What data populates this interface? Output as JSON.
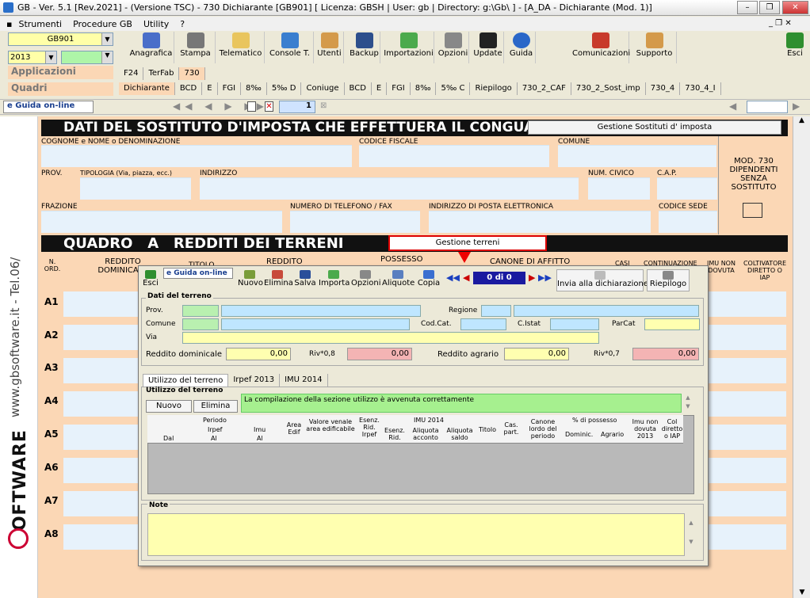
{
  "window": {
    "title": "GB - Ver. 5.1 [Rev.2021] - (Versione TSC) - 730 Dichiarante [GB901]    [ Licenza: GBSH | User: gb | Directory: g:\\Gb\\ ] - [A_DA - Dichiarante (Mod. 1)]"
  },
  "menu": [
    "Strumenti",
    "Procedure GB",
    "Utility",
    "?"
  ],
  "left": {
    "code": "GB901",
    "year": "2013",
    "applicazioni": "Applicazioni",
    "quadri": "Quadri"
  },
  "toolbar": [
    "Anagrafica",
    "Stampa",
    "Telematico",
    "Console T.",
    "Utenti",
    "Backup",
    "Importazioni",
    "Opzioni",
    "Update",
    "Guida"
  ],
  "toolbar_right": [
    "Comunicazioni",
    "Supporto"
  ],
  "exit": "Esci",
  "tabs1": [
    "F24",
    "TerFab",
    "730"
  ],
  "tabs2": [
    "Dichiarante",
    "BCD",
    "E",
    "FGI",
    "8‰",
    "5‰ D",
    "Coniuge",
    "BCD",
    "E",
    "FGI",
    "8‰",
    "5‰ C",
    "Riepilogo",
    "730_2_CAF",
    "730_2_Sost_imp",
    "730_4",
    "730_4_I"
  ],
  "nav": {
    "guide": "Guida on-line",
    "page": "1"
  },
  "sidebar": {
    "brand": "SOFTWARE",
    "url": "www.gbsoftware.it - Tel.06/"
  },
  "sostituto": {
    "heading": "DATI DEL SOSTITUTO D'IMPOSTA CHE EFFETTUERA IL CONGUAGLIO",
    "manage": "Gestione Sostituti d' imposta",
    "cognome": "COGNOME e NOME o DENOMINAZIONE",
    "cf": "CODICE FISCALE",
    "comune": "COMUNE",
    "prov": "PROV.",
    "tipologia": "TIPOLOGIA (Via, piazza, ecc.)",
    "indirizzo": "INDIRIZZO",
    "civico": "NUM. CIVICO",
    "cap": "C.A.P.",
    "frazione": "FRAZIONE",
    "telefono": "NUMERO DI TELEFONO / FAX",
    "email": "INDIRIZZO DI POSTA ELETTRONICA",
    "sede": "CODICE SEDE",
    "mod730": "MOD. 730 DIPENDENTI SENZA SOSTITUTO"
  },
  "quadro": {
    "heading": "QUADRO   A   REDDITI DEI TERRENI",
    "manage": "Gestione terreni",
    "cols": [
      "N. ORD.",
      "REDDITO DOMINICALE",
      "TITOLO",
      "REDDITO",
      "POSSESSO",
      "CANONE DI AFFITTO",
      "CASI",
      "CONTINUAZIONE",
      "IMU NON DOVUTA",
      "COLTIVATORE DIRETTO O IAP"
    ],
    "rows": [
      "A1",
      "A2",
      "A3",
      "A4",
      "A5",
      "A6",
      "A7",
      "A8"
    ]
  },
  "dialog": {
    "buttons": [
      "Esci",
      "Guida on-line",
      "Nuovo",
      "Elimina",
      "Salva",
      "Importa",
      "Opzioni",
      "Aliquote",
      "Copia"
    ],
    "counter": "0 di 0",
    "invia": "Invia alla dichiarazione",
    "riepilogo": "Riepilogo",
    "section": "Dati del terreno",
    "prov": "Prov.",
    "regione": "Regione",
    "comune": "Comune",
    "codcat": "Cod.Cat.",
    "cistat": "C.Istat",
    "parcat": "ParCat",
    "via": "Via",
    "rd_label": "Reddito dominicale",
    "rd": "0,00",
    "rd8_label": "Riv*0,8",
    "rd8": "0,00",
    "ra_label": "Reddito agrario",
    "ra": "0,00",
    "ra7_label": "Riv*0,7",
    "ra7": "0,00",
    "tabs": [
      "Utilizzo del terreno",
      "Irpef 2013",
      "IMU 2014"
    ],
    "util_title": "Utilizzo del terreno",
    "nuovo": "Nuovo",
    "elimina": "Elimina",
    "msg": "La compilazione della sezione utilizzo è avvenuta correttamente",
    "grid": {
      "periodo": "Periodo",
      "irpef": "Irpef",
      "imu": "Imu",
      "dal": "Dal",
      "al1": "Al",
      "al2": "Al",
      "area": "Area Edif",
      "venale": "Valore venale area edificabile",
      "esenz": "Esenz. Rid. Irpef",
      "imu2014": "IMU 2014",
      "esenz2": "Esenz. Rid.",
      "acconto": "Aliquota acconto",
      "saldo": "Aliquota saldo",
      "titolo": "Titolo",
      "cas": "Cas. part.",
      "canone": "Canone lordo del periodo",
      "poss": "% di possesso",
      "domin": "Dominic.",
      "agrario": "Agrario",
      "imunon": "Imu non dovuta 2013",
      "col": "Col diretto o IAP"
    },
    "note": "Note"
  }
}
